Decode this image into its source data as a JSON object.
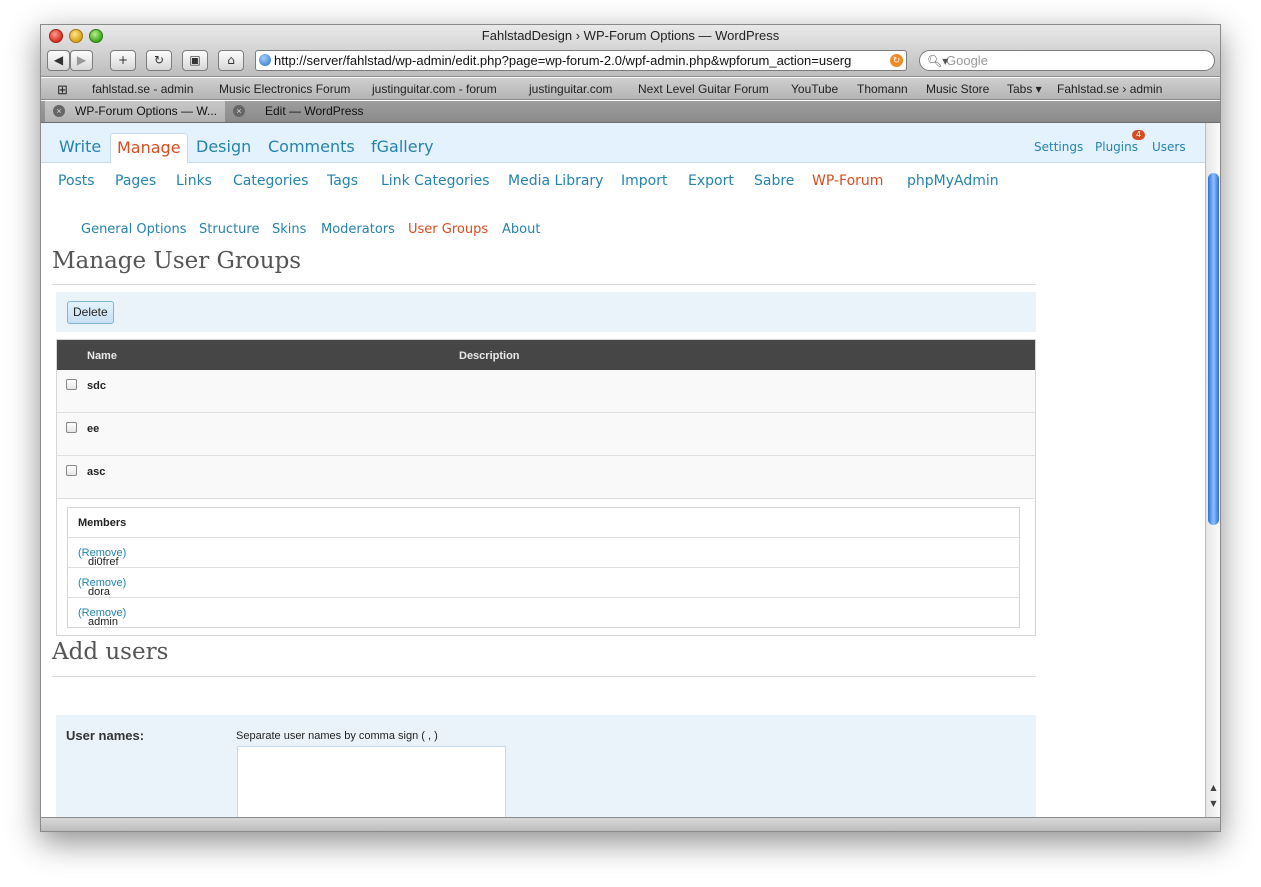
{
  "window": {
    "title": "FahlstadDesign › WP-Forum Options — WordPress"
  },
  "toolbar": {
    "url": "http://server/fahlstad/wp-admin/edit.php?page=wp-forum-2.0/wpf-admin.php&wpforum_action=userg",
    "search_placeholder": "Google"
  },
  "bookmarks": [
    "fahlstad.se - admin",
    "Music Electronics Forum",
    "justinguitar.com - forum",
    "justinguitar.com",
    "Next Level Guitar Forum",
    "YouTube",
    "Thomann",
    "Music Store",
    "Tabs ▾",
    "Fahlstad.se › admin"
  ],
  "tabs": [
    "WP-Forum Options — W...",
    "Edit — WordPress"
  ],
  "wp": {
    "main_menu": [
      "Write",
      "Manage",
      "Design",
      "Comments",
      "fGallery"
    ],
    "right_menu": [
      "Settings",
      "Plugins",
      "Users"
    ],
    "plugins_badge": "4",
    "sub_menu": [
      "Posts",
      "Pages",
      "Links",
      "Categories",
      "Tags",
      "Link Categories",
      "Media Library",
      "Import",
      "Export",
      "Sabre",
      "WP-Forum",
      "phpMyAdmin"
    ],
    "forum_menu": [
      "General Options",
      "Structure",
      "Skins",
      "Moderators",
      "User Groups",
      "About"
    ]
  },
  "manage": {
    "title": "Manage User Groups",
    "delete_label": "Delete",
    "col_name": "Name",
    "col_desc": "Description",
    "groups": [
      "sdc",
      "ee",
      "asc"
    ],
    "members_header": "Members",
    "members": [
      "di0fref",
      "dora",
      "admin"
    ],
    "remove_label": "(Remove)"
  },
  "add": {
    "title": "Add users",
    "label": "User names:",
    "hint": "Separate user names by comma sign ( , )"
  }
}
